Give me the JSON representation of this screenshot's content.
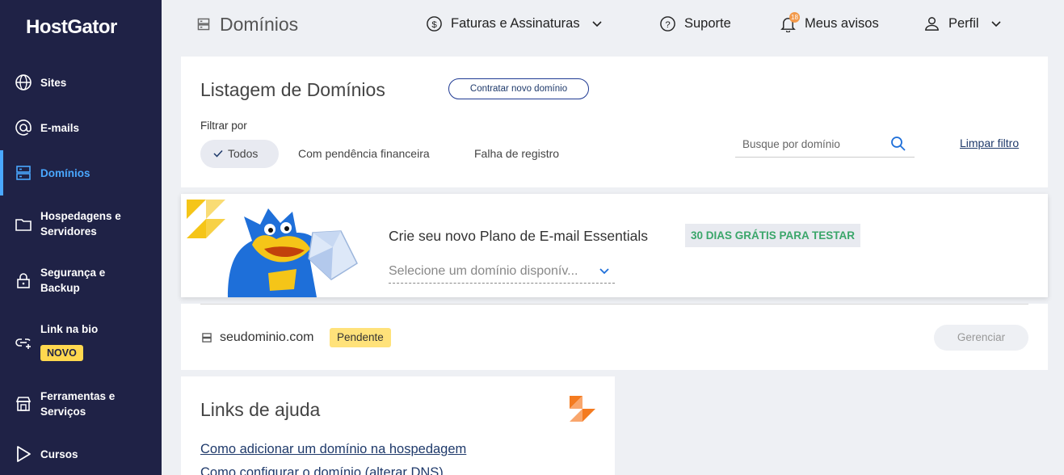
{
  "brand": {
    "logo_text": "HostGator"
  },
  "sidebar": {
    "items": [
      {
        "label": "Sites",
        "icon": "globe-icon"
      },
      {
        "label": "E-mails",
        "icon": "at-sign-icon"
      },
      {
        "label": "Domínios",
        "icon": "server-icon",
        "active": true
      },
      {
        "label": "Hospedagens e Servidores",
        "icon": "folder-icon"
      },
      {
        "label": "Segurança e Backup",
        "icon": "lock-icon"
      },
      {
        "label": "Link na bio",
        "icon": "link-icon",
        "badge": "NOVO"
      },
      {
        "label": "Ferramentas e Serviços",
        "icon": "store-icon"
      },
      {
        "label": "Cursos",
        "icon": "play-icon"
      }
    ]
  },
  "header": {
    "page_title": "Domínios",
    "billing": "Faturas e Assinaturas",
    "support": "Suporte",
    "notifications": "Meus avisos",
    "notifications_count": "18",
    "profile": "Perfil"
  },
  "listing": {
    "title": "Listagem de Domínios",
    "new_domain_button": "Contratar novo domínio",
    "filter_label": "Filtrar por",
    "filters": [
      "Todos",
      "Com pendência financeira",
      "Falha de registro"
    ],
    "active_filter": "Todos",
    "search_placeholder": "Busque por domínio",
    "clear_filter": "Limpar filtro"
  },
  "promo": {
    "text": "Crie seu novo Plano de E-mail Essentials",
    "badge": "30 DIAS GRÁTIS PARA TESTAR",
    "select_placeholder": "Selecione um domínio disponív...",
    "colors": {
      "accent": "#f5c518",
      "mascot": "#1e6fd9"
    }
  },
  "domains": [
    {
      "name": "seudominio.com",
      "status": "Pendente",
      "action": "Gerenciar"
    }
  ],
  "help": {
    "title": "Links de ajuda",
    "links": [
      "Como adicionar um domínio na hospedagem",
      "Como configurar o domínio (alterar DNS)"
    ]
  },
  "colors": {
    "sidebar_bg": "#1f2246",
    "active_nav": "#4aa8ff",
    "status_pending": "#ffe27a",
    "promo_badge_text": "#3aa66a"
  }
}
